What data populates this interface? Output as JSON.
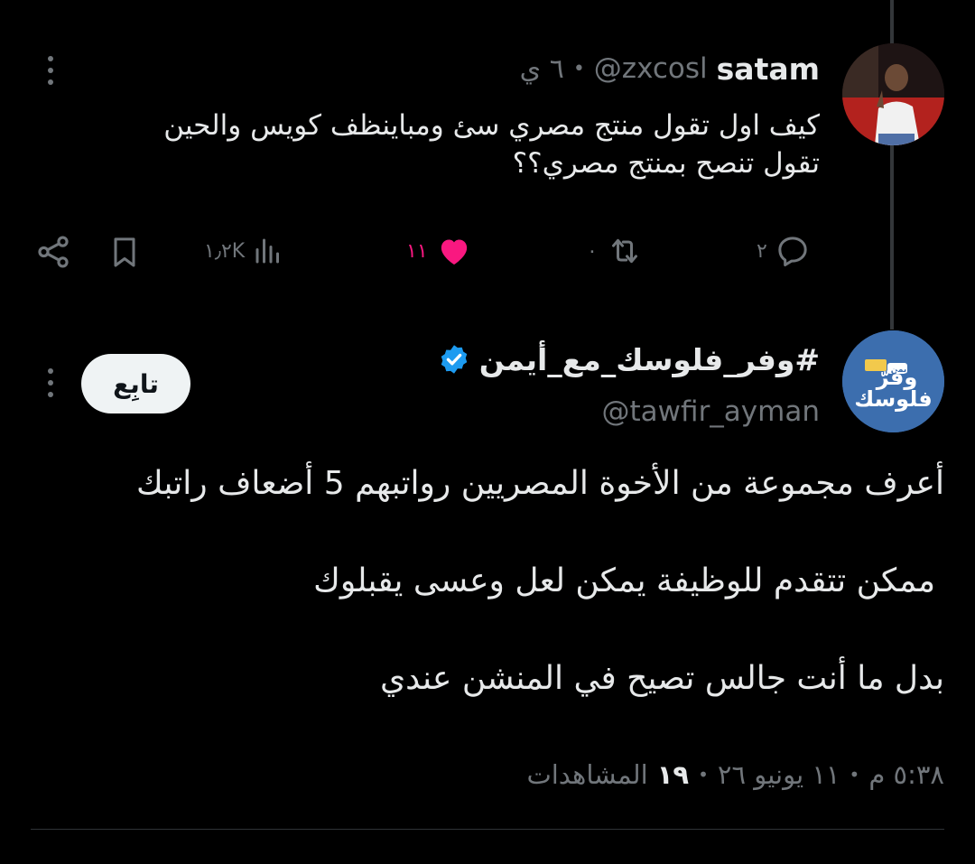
{
  "reply": {
    "name": "satam",
    "handle": "@zxcosl",
    "time": "٦ ي",
    "separator": "•",
    "text_line1": "كيف اول تقول منتج مصري سئ ومباينظف كويس والحين",
    "text_line2": "تقول تنصح بمنتج مصري؟؟",
    "actions": {
      "replies": "٢",
      "retweets": "٠",
      "likes": "١١",
      "views": "١٫٢K"
    }
  },
  "main": {
    "name": "#وفر_فلوسك_مع_أيمن",
    "handle": "@tawfir_ayman",
    "follow_label": "تابِع",
    "avatar_text_top": "وفرّ",
    "avatar_text_bottom": "فلوسك",
    "avatar_badge": "مع أيمن",
    "paragraph1": "أعرف مجموعة من الأخوة المصريين رواتبهم 5 أضعاف راتبك",
    "paragraph2": "ممكن تتقدم للوظيفة يمكن لعل وعسى يقبلوك",
    "paragraph3": "بدل ما أنت جالس تصيح في المنشن عندي",
    "meta_time": "٥:٣٨ م",
    "meta_date": "١١ يونيو ٢٦",
    "meta_views_count": "١٩",
    "meta_views_label": "المشاهدات",
    "meta_sep": "•"
  },
  "colors": {
    "like": "#f91880",
    "verified": "#1d9bf0",
    "muted": "#71767b",
    "text": "#e7e9ea",
    "background": "#000000"
  }
}
